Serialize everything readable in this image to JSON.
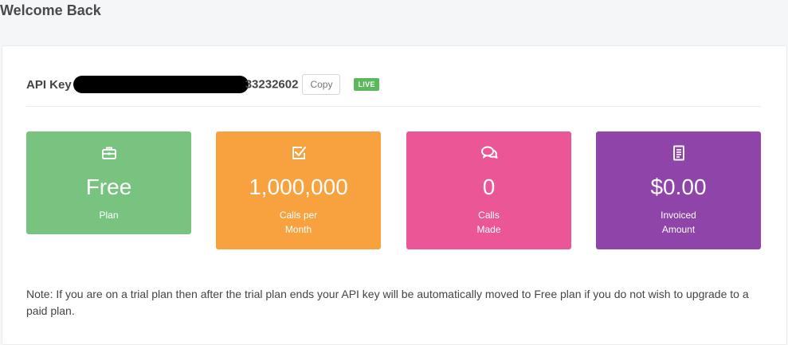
{
  "page": {
    "title": "Welcome Back"
  },
  "api": {
    "label": "API Key",
    "key_visible_suffix": "33232602",
    "copy_label": "Copy",
    "status_badge": "LIVE"
  },
  "cards": [
    {
      "icon": "briefcase-icon",
      "value": "Free",
      "caption": "Plan",
      "color": "#77c37f"
    },
    {
      "icon": "checkbox-icon",
      "value": "1,000,000",
      "caption_line1": "Calls per",
      "caption_line2": "Month",
      "color": "#f8a13f"
    },
    {
      "icon": "chat-bubbles-icon",
      "value": "0",
      "caption_line1": "Calls",
      "caption_line2": "Made",
      "color": "#ea5696"
    },
    {
      "icon": "document-icon",
      "value": "$0.00",
      "caption_line1": "Invoiced",
      "caption_line2": "Amount",
      "color": "#8f44aa"
    }
  ],
  "note": "Note: If you are on a trial plan then after the trial plan ends your API key will be automatically moved to Free plan if you do not wish to upgrade to a paid plan.",
  "colors": {
    "live_badge": "#5cb85c",
    "page_background": "#f5f6f8",
    "panel_background": "#ffffff"
  }
}
